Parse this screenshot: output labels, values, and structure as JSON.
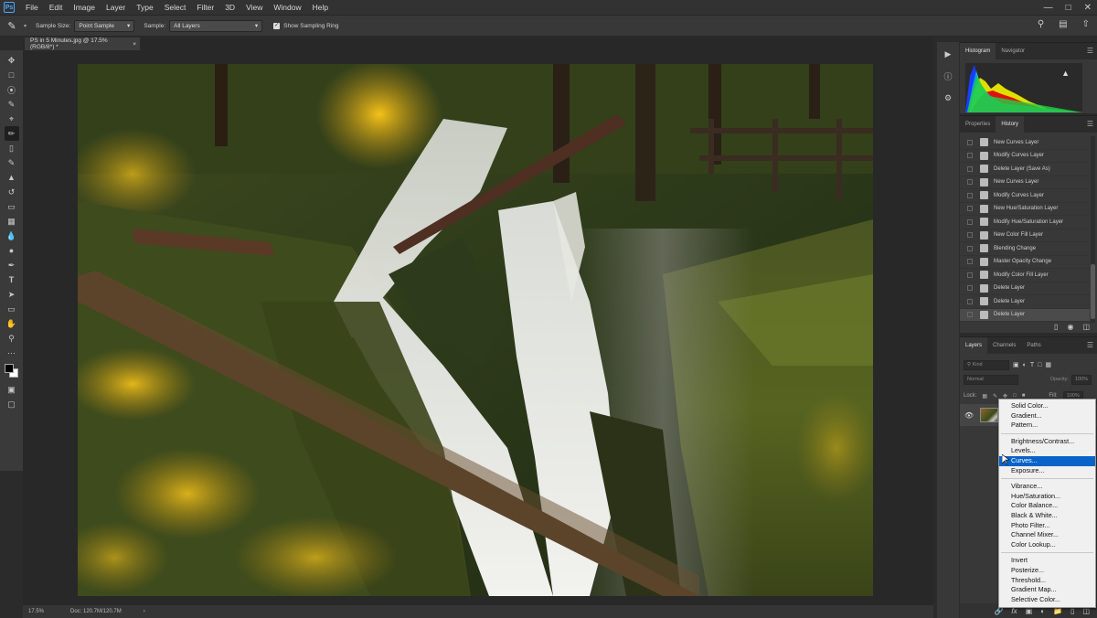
{
  "app": {
    "logo_text": "Ps"
  },
  "menubar": {
    "items": [
      "File",
      "Edit",
      "Image",
      "Layer",
      "Type",
      "Select",
      "Filter",
      "3D",
      "View",
      "Window",
      "Help"
    ]
  },
  "options": {
    "sample_size_label": "Sample Size:",
    "sample_size_value": "Point Sample",
    "sample_label": "Sample:",
    "sample_value": "All Layers",
    "sampling_ring_label": "Show Sampling Ring",
    "sampling_ring_checked": true
  },
  "document": {
    "tab_title": "PS in 5 Minutes.jpg @ 17.5% (RGB/8*) *",
    "tab_close": "×"
  },
  "status": {
    "zoom": "17.5%",
    "doc_size": "Doc: 120.7M/120.7M",
    "arrow": "›"
  },
  "histogram_panel": {
    "tabs": [
      "Histogram",
      "Navigator"
    ],
    "active_tab": "Histogram",
    "warning_glyph": "▲"
  },
  "history_panel": {
    "tabs": [
      "Properties",
      "History"
    ],
    "active_tab": "History",
    "items": [
      "New Curves Layer",
      "Modify Curves Layer",
      "Delete Layer (Save As)",
      "New Curves Layer",
      "Modify Curves Layer",
      "New Hue/Saturation Layer",
      "Modify Hue/Saturation Layer",
      "New Color Fill Layer",
      "Blending Change",
      "Master Opacity Change",
      "Modify Color Fill Layer",
      "Delete Layer",
      "Delete Layer",
      "Delete Layer"
    ],
    "selected_index": 13
  },
  "layers_panel": {
    "tabs": [
      "Layers",
      "Channels",
      "Paths"
    ],
    "active_tab": "Layers",
    "filter_placeholder": "Kind",
    "blend_mode": "Normal",
    "opacity_label": "Opacity:",
    "opacity_value": "100%",
    "lock_label": "Lock:",
    "fill_label": "Fill:",
    "fill_value": "100%"
  },
  "adjustment_menu": {
    "groups": [
      [
        "Solid Color...",
        "Gradient...",
        "Pattern..."
      ],
      [
        "Brightness/Contrast...",
        "Levels...",
        "Curves...",
        "Exposure..."
      ],
      [
        "Vibrance...",
        "Hue/Saturation...",
        "Color Balance...",
        "Black & White...",
        "Photo Filter...",
        "Channel Mixer...",
        "Color Lookup..."
      ],
      [
        "Invert",
        "Posterize...",
        "Threshold...",
        "Gradient Map...",
        "Selective Color..."
      ]
    ],
    "highlighted": "Curves...",
    "highlight_color": "#0a63c8"
  },
  "colors": {
    "foreground": "#000000",
    "background": "#ffffff"
  }
}
